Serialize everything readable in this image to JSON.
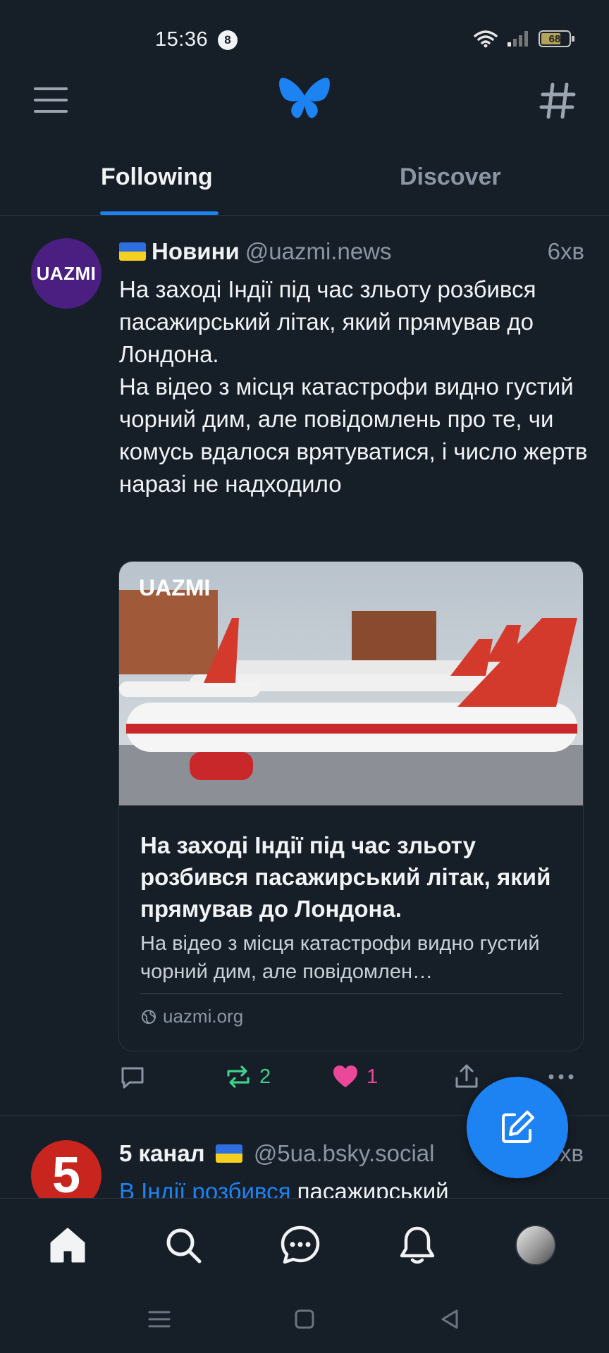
{
  "status_bar": {
    "time": "15:36",
    "notification_count": "8",
    "battery": "68"
  },
  "header": {
    "logo": "butterfly-icon"
  },
  "tabs": [
    {
      "label": "Following",
      "active": true
    },
    {
      "label": "Discover",
      "active": false
    }
  ],
  "post": {
    "avatar_text": "UAZMI",
    "author": "Новини",
    "handle": "@uazmi.news",
    "time": "6хв",
    "text": "На заході Індії під час зльоту розбився пасажирський літак, який прямував до Лондона.\nНа відео з місця катастрофи видно густий чорний дим, але повідомлень про те, чи комусь вдалося врятуватися, і число жертв наразі не надходило",
    "embed": {
      "image_logo": "UAZMI",
      "title": "На заході Індії під час зльоту розбився пасажирський літак, який прямував до Лондона.",
      "description": "На відео з місця катастрофи видно густий чорний дим, але повідомлен…",
      "domain": "uazmi.org"
    },
    "actions": {
      "reposts": "2",
      "likes": "1"
    }
  },
  "next_post": {
    "avatar_text": "5",
    "author": "5 канал",
    "handle": "@5ua.bsky.social",
    "time": "6хв",
    "link_text": "В Індії розбився",
    "text_after": " пасажирський"
  },
  "colors": {
    "background": "#161e27",
    "accent": "#1d83f2",
    "repost": "#3fd08c",
    "like": "#ec4899",
    "muted": "#8a96a3"
  }
}
